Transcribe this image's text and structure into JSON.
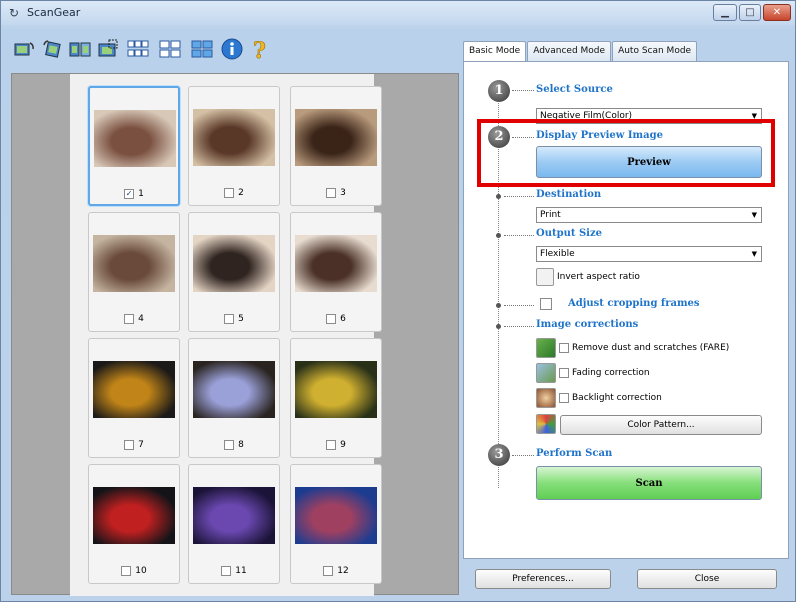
{
  "window": {
    "title": "ScanGear"
  },
  "toolbar": {
    "buttons": [
      {
        "icon": "rotate-left-icon"
      },
      {
        "icon": "rotate-right-icon"
      },
      {
        "icon": "mirror-icon"
      },
      {
        "icon": "crop-icon"
      },
      {
        "icon": "small-thumbnails-icon"
      },
      {
        "icon": "medium-thumbnails-icon"
      },
      {
        "icon": "large-thumbnails-icon"
      },
      {
        "icon": "info-icon"
      },
      {
        "icon": "help-icon"
      }
    ]
  },
  "frames": [
    {
      "label": "1",
      "checked": true,
      "colors": [
        "#d8c8b8",
        "#7a5040"
      ]
    },
    {
      "label": "2",
      "checked": false,
      "colors": [
        "#d4c0a4",
        "#5a3828"
      ]
    },
    {
      "label": "3",
      "checked": false,
      "colors": [
        "#b89a7c",
        "#3a2418"
      ]
    },
    {
      "label": "4",
      "checked": false,
      "colors": [
        "#c4b4a0",
        "#6a4a3a"
      ]
    },
    {
      "label": "5",
      "checked": false,
      "colors": [
        "#e4d4c4",
        "#302420"
      ]
    },
    {
      "label": "6",
      "checked": false,
      "colors": [
        "#e8dcd0",
        "#4a3026"
      ]
    },
    {
      "label": "7",
      "checked": false,
      "colors": [
        "#1c1a18",
        "#c08418"
      ]
    },
    {
      "label": "8",
      "checked": false,
      "colors": [
        "#2a2420",
        "#9aa0d8"
      ]
    },
    {
      "label": "9",
      "checked": false,
      "colors": [
        "#283018",
        "#d0b030"
      ]
    },
    {
      "label": "10",
      "checked": false,
      "colors": [
        "#141418",
        "#c02020"
      ]
    },
    {
      "label": "11",
      "checked": false,
      "colors": [
        "#1c1438",
        "#6a48b0"
      ]
    },
    {
      "label": "12",
      "checked": false,
      "colors": [
        "#1c3c90",
        "#a04060"
      ]
    }
  ],
  "tabs": [
    "Basic Mode",
    "Advanced Mode",
    "Auto Scan Mode"
  ],
  "steps": {
    "select_source": {
      "number": "1",
      "title": "Select Source",
      "value": "Negative Film(Color)"
    },
    "preview": {
      "number": "2",
      "title": "Display Preview Image",
      "button": "Preview"
    },
    "destination": {
      "title": "Destination",
      "value": "Print"
    },
    "output_size": {
      "title": "Output Size",
      "value": "Flexible",
      "invert_label": "Invert aspect ratio"
    },
    "adjust_cropping": {
      "label": "Adjust cropping frames"
    },
    "image_corrections": {
      "title": "Image corrections",
      "options": [
        {
          "label": "Remove dust and scratches (FARE)",
          "icon": "dust-removal-icon"
        },
        {
          "label": "Fading correction",
          "icon": "fading-correction-icon"
        },
        {
          "label": "Backlight correction",
          "icon": "backlight-correction-icon"
        }
      ],
      "color_pattern": "Color Pattern..."
    },
    "perform_scan": {
      "number": "3",
      "title": "Perform Scan",
      "button": "Scan"
    }
  },
  "footer": {
    "preferences": "Preferences...",
    "close": "Close"
  },
  "colors": {
    "highlight": "#e00000",
    "section_title": "#1f74c9",
    "preview_button": "#9ccbf3",
    "scan_button": "#86df7a"
  }
}
